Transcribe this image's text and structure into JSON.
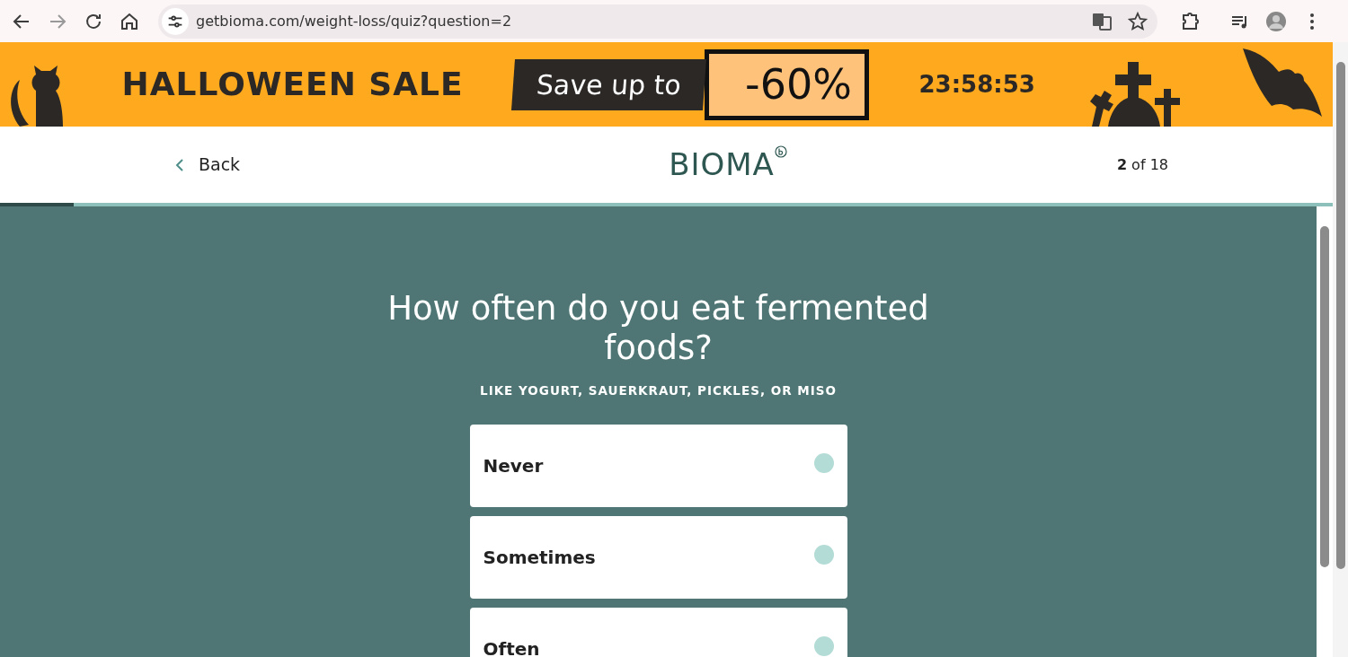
{
  "browser": {
    "url": "getbioma.com/weight-loss/quiz?question=2"
  },
  "banner": {
    "title": "HALLOWEEN SALE",
    "offer_label": "Save up to",
    "offer_value": "-60%",
    "countdown": "23:58:53"
  },
  "header": {
    "back": "Back",
    "logo": "BIOMA",
    "progress_text": "**2** of 18"
  },
  "progress": {
    "level": 0.055
  },
  "question": {
    "title": "How often do you eat fermented foods?",
    "subtitle": "LIKE YOGURT, SAUERKRAUT, PICKLES, OR MISO"
  },
  "options": [
    {
      "label": "Never",
      "selected": false
    },
    {
      "label": "Sometimes",
      "selected": false
    },
    {
      "label": "Often",
      "selected": false
    }
  ]
}
